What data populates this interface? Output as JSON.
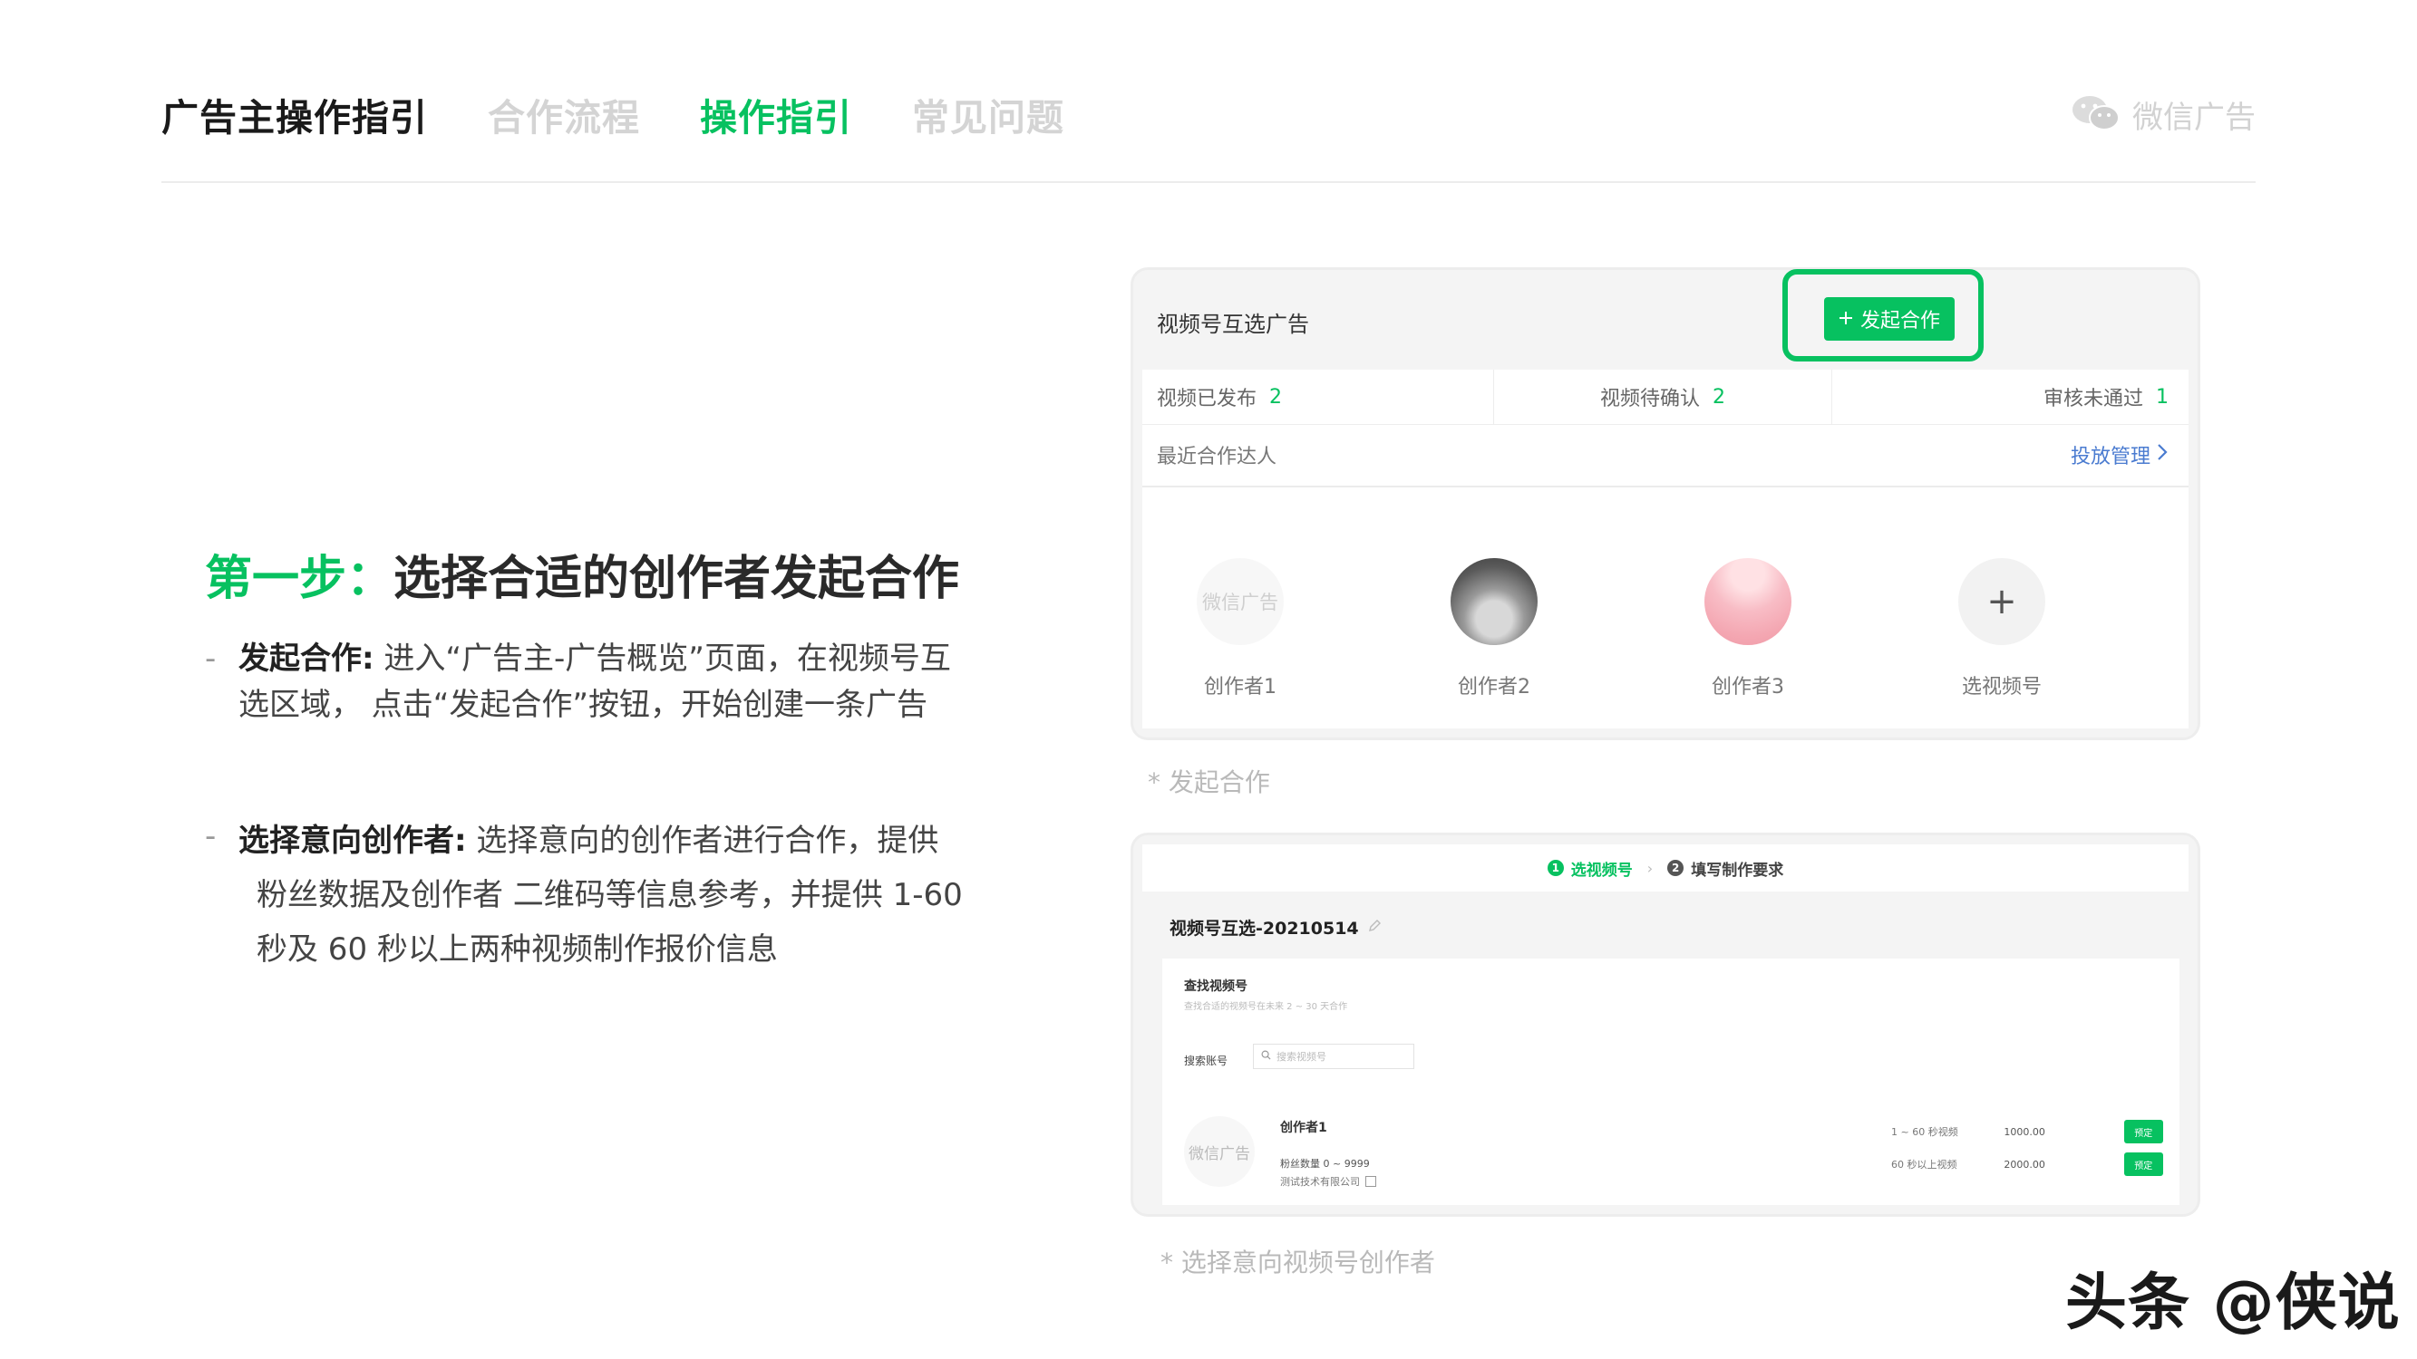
{
  "header": {
    "title": "广告主操作指引",
    "tabs": [
      {
        "label": "合作流程"
      },
      {
        "label": "操作指引"
      },
      {
        "label": "常见问题"
      }
    ],
    "brand": "微信广告"
  },
  "content": {
    "step_prefix": "第一步：",
    "step_title": "选择合适的创作者发起合作",
    "bullets": [
      {
        "dash": "-",
        "title": "发起合作:",
        "text": " 进入“广告主-广告概览”页面，在视频号互选区域，  点击“发起合作”按钮，开始创建一条广告"
      },
      {
        "dash": "-",
        "title": "选择意向创作者:",
        "line1": " 选择意向的创作者进行合作，提供",
        "line2": "粉丝数据及创作者 二维码等信息参考，并提供 1-60",
        "line3": "秒及 60 秒以上两种视频制作报价信息"
      }
    ]
  },
  "screenshot1": {
    "title": "视频号互选广告",
    "start_button": "发起合作",
    "stats": [
      {
        "label": "视频已发布",
        "value": "2"
      },
      {
        "label": "视频待确认",
        "value": "2"
      },
      {
        "label": "审核未通过",
        "value": "1"
      }
    ],
    "recent_label": "最近合作达人",
    "manage_link": "投放管理",
    "creators": [
      {
        "avatar_text": "微信广告",
        "name": "创作者1"
      },
      {
        "avatar_text": "",
        "name": "创作者2"
      },
      {
        "avatar_text": "",
        "name": "创作者3"
      },
      {
        "avatar_text": "+",
        "name": "选视频号"
      }
    ],
    "caption": "* 发起合作"
  },
  "screenshot2": {
    "steps": [
      {
        "num": "1",
        "label": "选视频号"
      },
      {
        "num": "2",
        "label": "填写制作要求"
      }
    ],
    "step_sep": "›",
    "title": "视频号互选-20210514",
    "find_title": "查找视频号",
    "find_sub": "查找合适的视频号在未来 2 ~ 30 天合作",
    "search_label": "搜索账号",
    "search_placeholder": "搜索视频号",
    "creator": {
      "avatar_text": "微信广告",
      "name": "创作者1",
      "fans": "粉丝数量 0 ~ 9999",
      "company": "测试技术有限公司"
    },
    "prices": [
      {
        "label": "1 ~ 60 秒视频",
        "value": "1000.00",
        "button": "预定"
      },
      {
        "label": "60 秒以上视频",
        "value": "2000.00",
        "button": "预定"
      }
    ],
    "caption": "* 选择意向视频号创作者"
  },
  "watermark": "头条 @侠说",
  "colors": {
    "accent": "#07c160",
    "muted_tab": "#d4d4d4",
    "link": "#4a7bd0"
  },
  "icons": {
    "brand": "wechat-icon",
    "plus": "plus-icon",
    "manage": "chevron-right-icon",
    "search": "search-icon",
    "edit": "pencil-icon",
    "qr": "qr-code-icon"
  }
}
